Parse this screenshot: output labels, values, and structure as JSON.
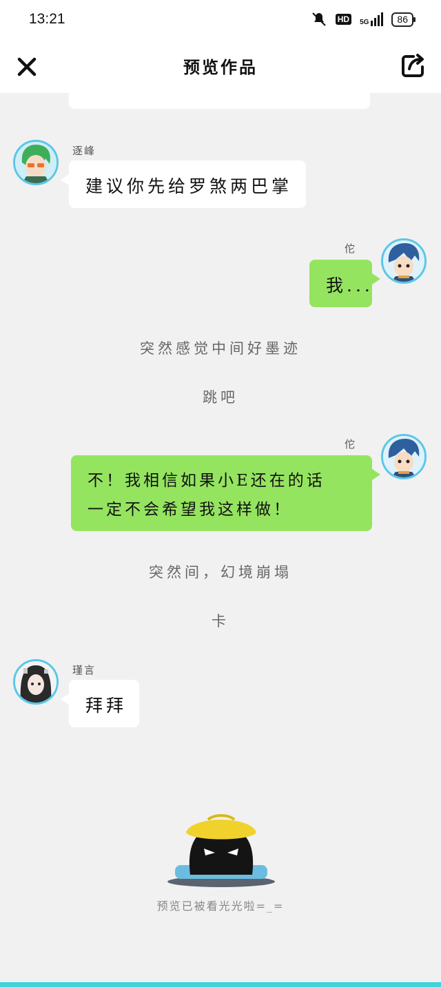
{
  "status": {
    "time": "13:21",
    "hd": "HD",
    "network": "5G",
    "battery": "86"
  },
  "nav": {
    "title": "预览作品"
  },
  "messages": [
    {
      "name": "逐峰",
      "text": "建议你先给罗煞两巴掌"
    },
    {
      "name": "佗",
      "text": "我..."
    },
    {
      "narration": "突然感觉中间好墨迹"
    },
    {
      "narration": "跳吧"
    },
    {
      "name": "佗",
      "line1": "不！我相信如果小E还在的话",
      "line2": "一定不会希望我这样做！"
    },
    {
      "narration": "突然间，幻境崩塌"
    },
    {
      "narration": "卡"
    },
    {
      "name": "瑾言",
      "text": "拜拜"
    }
  ],
  "footer": {
    "text": "预览已被看光光啦=_="
  },
  "colors": {
    "accent": "#59c7e8",
    "bubble_green": "#95e460",
    "bottom_bar": "#3fd3dc"
  }
}
